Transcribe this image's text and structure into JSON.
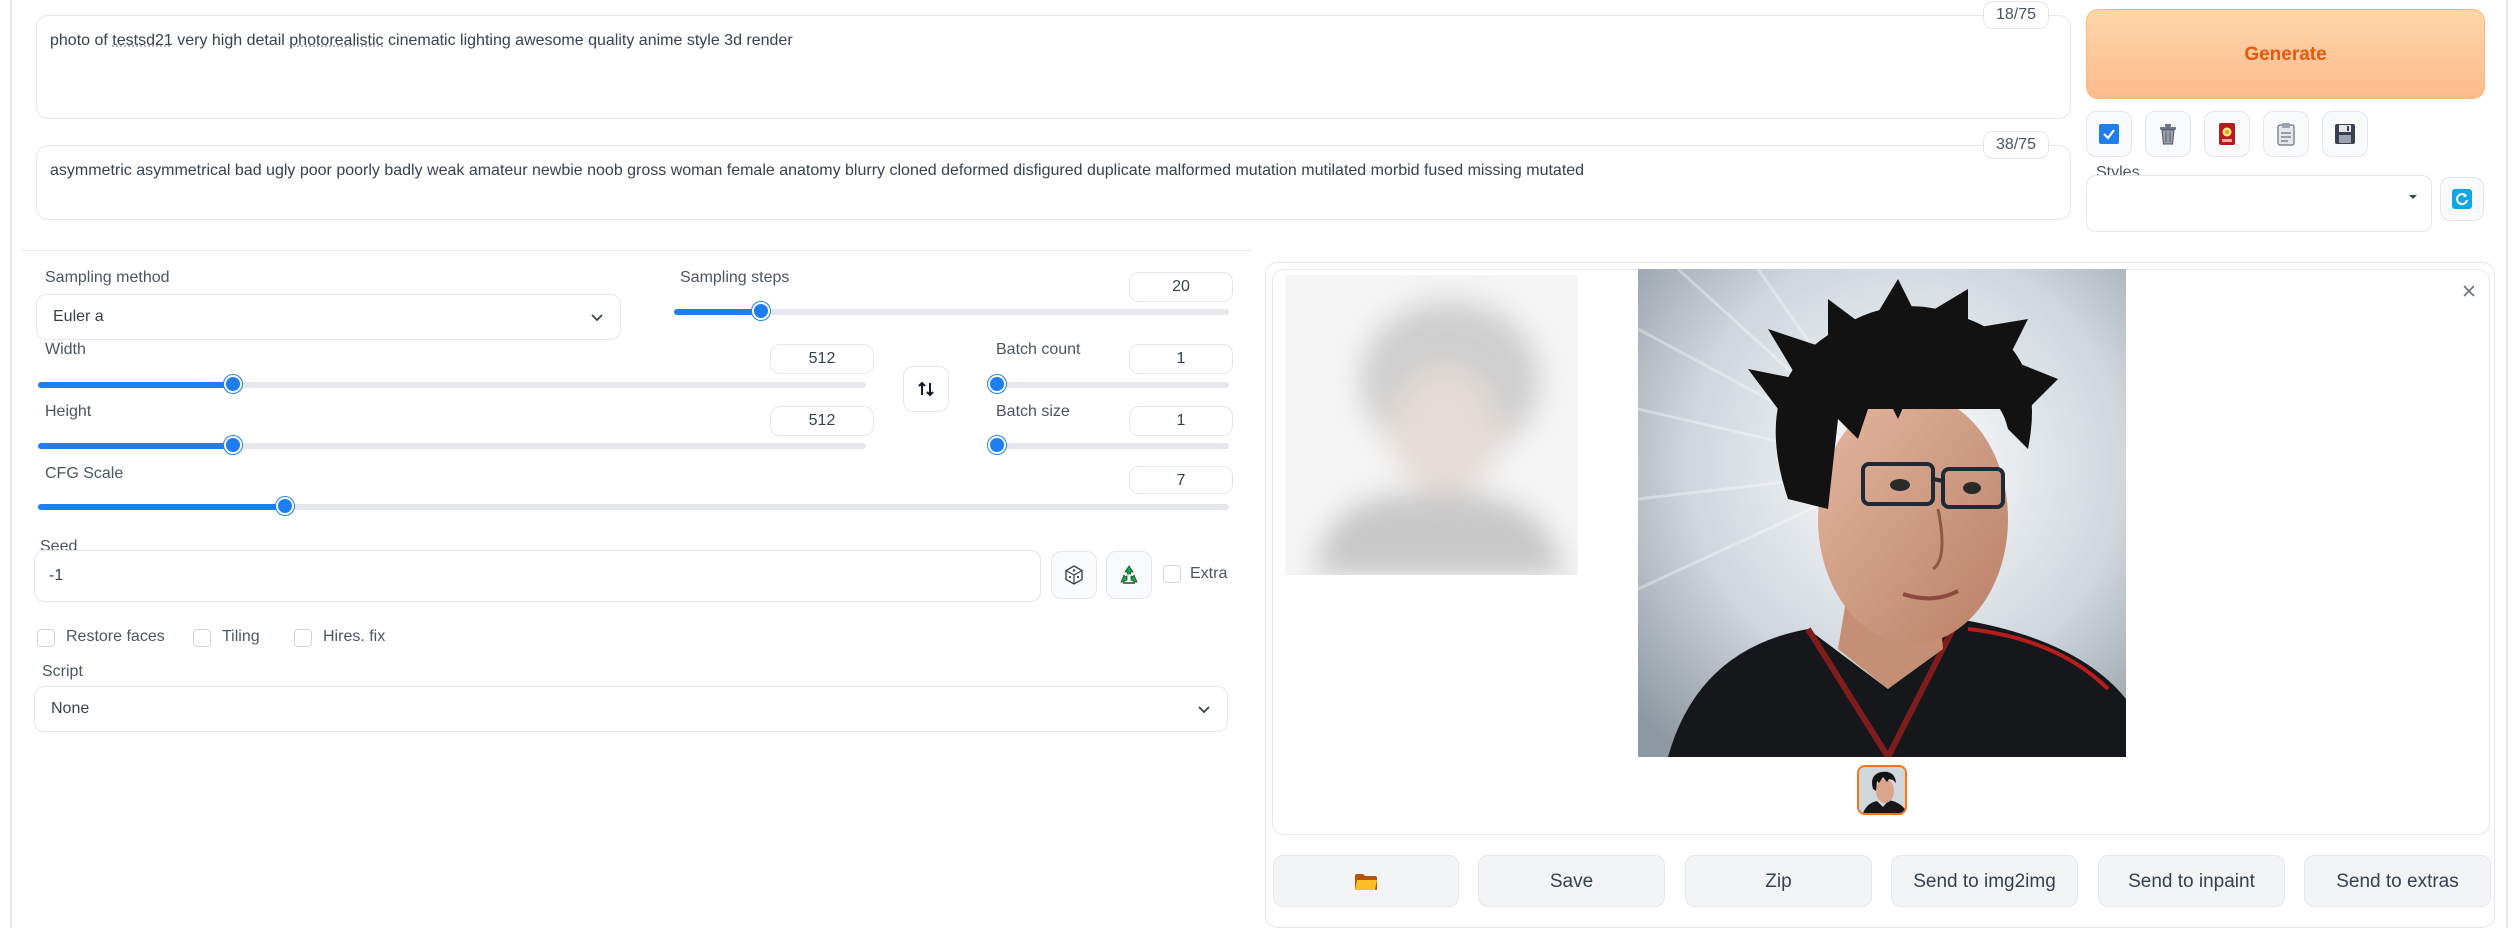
{
  "prompt": {
    "counter": "18/75",
    "text_parts": [
      {
        "t": "photo of ",
        "u": false
      },
      {
        "t": "testsd21",
        "u": true
      },
      {
        "t": " very high detail ",
        "u": false
      },
      {
        "t": "photorealistic",
        "u": true
      },
      {
        "t": " cinematic lighting awesome quality anime style 3d render",
        "u": false
      }
    ]
  },
  "negative_prompt": {
    "counter": "38/75",
    "text": "asymmetric asymmetrical bad ugly poor poorly badly weak amateur newbie noob gross woman female anatomy blurry cloned deformed disfigured duplicate malformed mutation mutilated morbid fused missing mutated"
  },
  "generate": {
    "label": "Generate"
  },
  "styles": {
    "label": "Styles",
    "value": ""
  },
  "sampling_method": {
    "label": "Sampling method",
    "value": "Euler a"
  },
  "sampling_steps": {
    "label": "Sampling steps",
    "value": "20",
    "fraction": 0.157
  },
  "width": {
    "label": "Width",
    "value": "512",
    "fraction": 0.235
  },
  "height": {
    "label": "Height",
    "value": "512",
    "fraction": 0.235
  },
  "batch_count": {
    "label": "Batch count",
    "value": "1",
    "fraction": 0.0
  },
  "batch_size": {
    "label": "Batch size",
    "value": "1",
    "fraction": 0.0
  },
  "cfg_scale": {
    "label": "CFG Scale",
    "value": "7",
    "fraction": 0.207
  },
  "seed": {
    "label": "Seed",
    "value": "-1",
    "extra_label": "Extra"
  },
  "options": {
    "restore_faces": "Restore faces",
    "tiling": "Tiling",
    "hires_fix": "Hires. fix"
  },
  "script": {
    "label": "Script",
    "value": "None"
  },
  "actions": {
    "save": "Save",
    "zip": "Zip",
    "send_img2img": "Send to img2img",
    "send_inpaint": "Send to inpaint",
    "send_extras": "Send to extras"
  },
  "colors": {
    "accent": "#1d7ef0",
    "generate": "#ea580c"
  }
}
